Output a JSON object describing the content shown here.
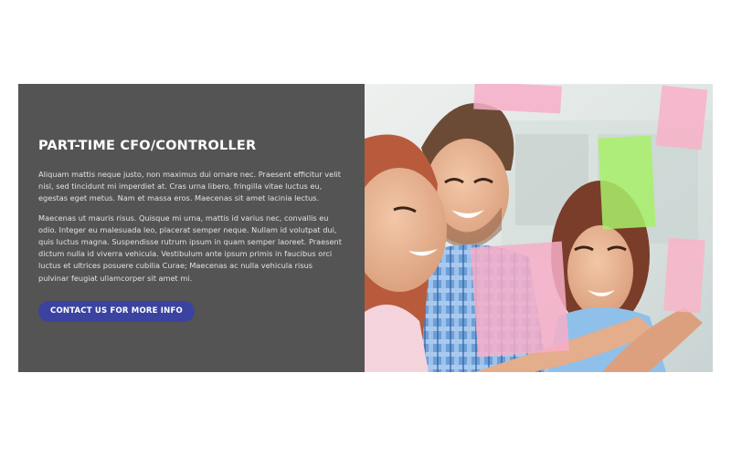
{
  "hero": {
    "title": "PART-TIME CFO/CONTROLLER",
    "paragraph_1": "Aliquam mattis neque justo, non maximus dui ornare nec. Praesent efficitur velit nisl, sed tincidunt mi imperdiet at. Cras urna libero, fringilla vitae luctus eu, egestas eget metus. Nam et massa eros. Maecenas sit amet lacinia lectus.",
    "paragraph_2": "Maecenas ut mauris risus. Quisque mi urna, mattis id varius nec, convallis eu odio. Integer eu malesuada leo, placerat semper neque. Nullam id volutpat dui, quis luctus magna. Suspendisse rutrum ipsum in quam semper laoreet. Praesent dictum nulla id viverra vehicula. Vestibulum ante ipsum primis in faucibus orci luctus et ultrices posuere cubilia Curae; Maecenas ac nulla vehicula risus pulvinar feugiat ullamcorper sit amet mi.",
    "cta_label": "CONTACT US FOR MORE INFO"
  },
  "colors": {
    "panel_background": "#545454",
    "cta_background": "#3a43a0",
    "page_background": "#ffffff"
  },
  "photo": {
    "subject": "three smiling colleagues placing sticky notes on glass"
  }
}
